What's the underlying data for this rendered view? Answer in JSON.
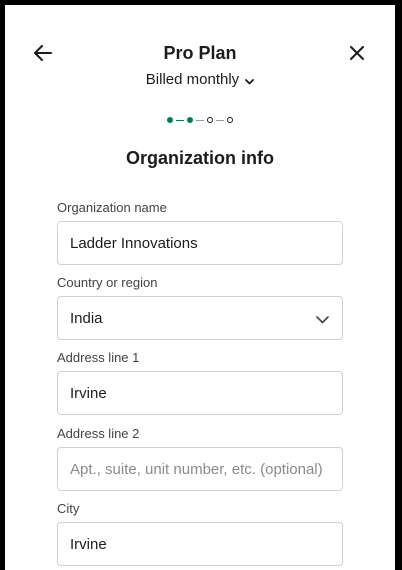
{
  "header": {
    "title": "Pro Plan",
    "billing_label": "Billed monthly",
    "back_icon": "arrow-left-icon",
    "close_icon": "close-icon"
  },
  "progress": {
    "current_step": 2,
    "total_steps": 4,
    "accent": "#007a5a"
  },
  "section": {
    "title": "Organization info"
  },
  "form": {
    "org_name": {
      "label": "Organization name",
      "value": "Ladder Innovations"
    },
    "country": {
      "label": "Country or region",
      "value": "India"
    },
    "address1": {
      "label": "Address line 1",
      "value": "Irvine"
    },
    "address2": {
      "label": "Address line 2",
      "placeholder": "Apt., suite, unit number, etc. (optional)"
    },
    "city": {
      "label": "City",
      "value": "Irvine"
    }
  }
}
